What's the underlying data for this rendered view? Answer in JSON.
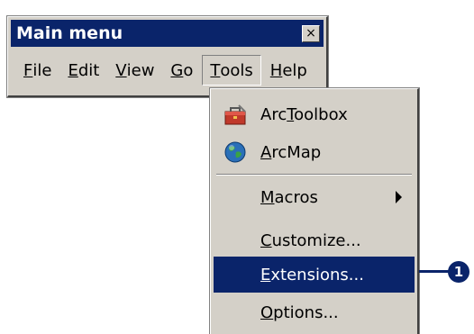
{
  "window": {
    "title": "Main menu",
    "close_glyph": "×"
  },
  "menubar": {
    "items": [
      {
        "label_u": "F",
        "label_rest": "ile"
      },
      {
        "label_u": "E",
        "label_rest": "dit"
      },
      {
        "label_u": "V",
        "label_rest": "iew"
      },
      {
        "label_u": "G",
        "label_rest": "o"
      },
      {
        "label_u": "T",
        "label_rest": "ools"
      },
      {
        "label_u": "H",
        "label_rest": "elp"
      }
    ],
    "active": "Tools"
  },
  "dropdown": {
    "arctoolbox": {
      "pre": "Arc",
      "u": "T",
      "post": "oolbox",
      "icon": "toolbox-icon"
    },
    "arcmap": {
      "pre": "",
      "u": "A",
      "post": "rcMap",
      "icon": "globe-icon"
    },
    "macros": {
      "pre": "",
      "u": "M",
      "post": "acros"
    },
    "customize": {
      "pre": "",
      "u": "C",
      "post": "ustomize..."
    },
    "extensions": {
      "pre": "",
      "u": "E",
      "post": "xtensions..."
    },
    "options": {
      "pre": "",
      "u": "O",
      "post": "ptions..."
    }
  },
  "callout": {
    "number": "1"
  },
  "colors": {
    "titlebar": "#0a246a",
    "highlight": "#0a246a",
    "face": "#d4d0c8"
  }
}
